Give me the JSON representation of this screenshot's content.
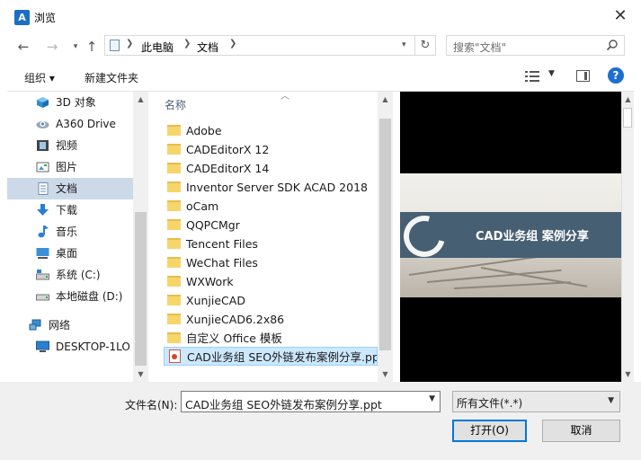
{
  "window": {
    "title": "浏览",
    "app_icon_text": "A"
  },
  "nav": {
    "breadcrumb": [
      "此电脑",
      "文档"
    ],
    "search_placeholder": "搜索\"文档\""
  },
  "toolbar": {
    "organize": "组织 ▾",
    "new_folder": "新建文件夹",
    "help": "?"
  },
  "sidebar": {
    "items": [
      {
        "label": "3D 对象",
        "icon": "cube-3d-icon",
        "selected": false
      },
      {
        "label": "A360 Drive",
        "icon": "a360-cloud-icon",
        "selected": false
      },
      {
        "label": "视频",
        "icon": "video-icon",
        "selected": false
      },
      {
        "label": "图片",
        "icon": "picture-icon",
        "selected": false
      },
      {
        "label": "文档",
        "icon": "document-icon",
        "selected": true
      },
      {
        "label": "下载",
        "icon": "download-icon",
        "selected": false
      },
      {
        "label": "音乐",
        "icon": "music-icon",
        "selected": false
      },
      {
        "label": "桌面",
        "icon": "desktop-icon",
        "selected": false
      },
      {
        "label": "系统 (C:)",
        "icon": "system-drive-icon",
        "selected": false
      },
      {
        "label": "本地磁盘 (D:)",
        "icon": "local-drive-icon",
        "selected": false
      },
      {
        "label": "网络",
        "icon": "network-icon",
        "selected": false
      },
      {
        "label": "DESKTOP-1LO",
        "icon": "computer-icon",
        "selected": false
      }
    ]
  },
  "file_list": {
    "column_header": "名称",
    "items": [
      {
        "name": "Adobe",
        "type": "folder"
      },
      {
        "name": "CADEditorX 12",
        "type": "folder"
      },
      {
        "name": "CADEditorX 14",
        "type": "folder"
      },
      {
        "name": "Inventor Server SDK ACAD 2018",
        "type": "folder"
      },
      {
        "name": "oCam",
        "type": "folder"
      },
      {
        "name": "QQPCMgr",
        "type": "folder"
      },
      {
        "name": "Tencent Files",
        "type": "folder"
      },
      {
        "name": "WeChat Files",
        "type": "folder"
      },
      {
        "name": "WXWork",
        "type": "folder"
      },
      {
        "name": "XunjieCAD",
        "type": "folder"
      },
      {
        "name": "XunjieCAD6.2x86",
        "type": "folder"
      },
      {
        "name": "自定义 Office 模板",
        "type": "folder"
      },
      {
        "name": "CAD业务组 SEO外链发布案例分享.ppt",
        "type": "ppt",
        "selected": true
      }
    ]
  },
  "preview": {
    "banner_text": "CAD业务组 案例分享"
  },
  "footer": {
    "filename_label": "文件名(N):",
    "filename_value": "CAD业务组 SEO外链发布案例分享.ppt",
    "filetype_value": "所有文件(*.*)",
    "open_button": "打开(O)",
    "cancel_button": "取消"
  },
  "colors": {
    "selection": "#cce8ff",
    "nav_selection": "#ccd9e8",
    "banner": "#465f72",
    "accent": "#0078d7"
  }
}
